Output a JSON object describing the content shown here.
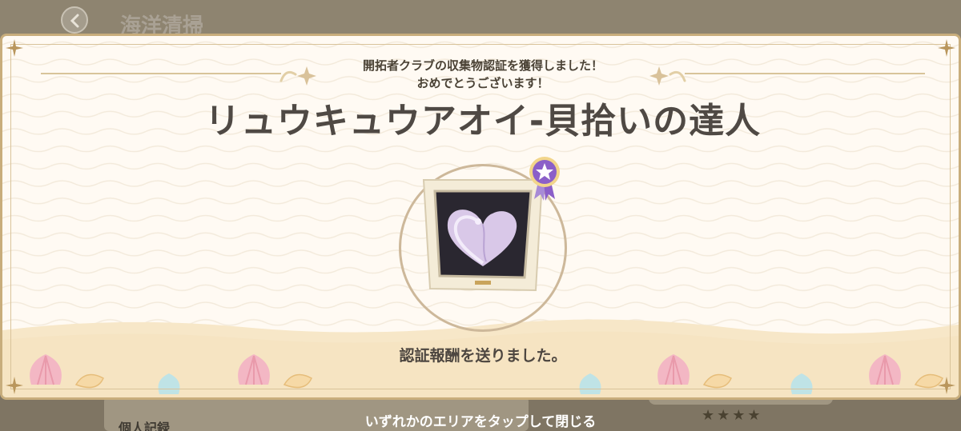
{
  "background": {
    "screen_title": "海洋清掃",
    "section_label": "個人記録",
    "stars_display": "★★★★"
  },
  "modal": {
    "message_line1": "開拓者クラブの収集物認証を獲得しました！",
    "message_line2": "おめでとうございます！",
    "achievement_title": "リュウキュウアオイ-貝拾いの達人",
    "reward_message": "認証報酬を送りました。"
  },
  "footer": {
    "close_hint": "いずれかのエリアをタップして閉じる"
  },
  "colors": {
    "modal_border": "#c8ad7c",
    "modal_bg": "#fffaf3",
    "title_text": "#4f4944",
    "sand": "#f6e6c8",
    "shell_pink": "#f3b7c4",
    "shell_teal": "#bfe3e6",
    "medal_purple": "#8b5fc8"
  },
  "icons": [
    "back-arrow-icon",
    "corner-star-icon",
    "sparkle-icon",
    "purple-medal-icon",
    "heart-shell-icon",
    "scallop-shell-icon",
    "conch-shell-icon"
  ]
}
